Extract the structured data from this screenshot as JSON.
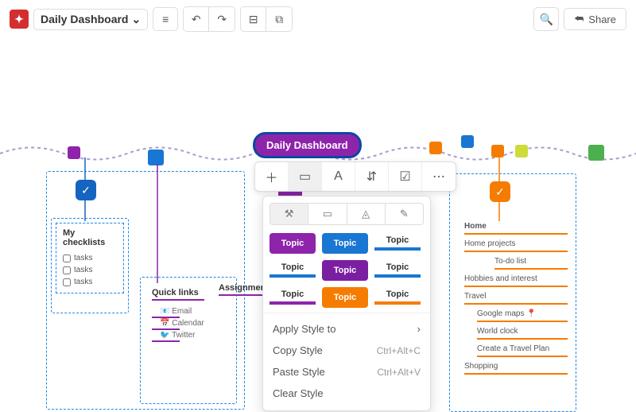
{
  "header": {
    "doc_title": "Daily Dashboard",
    "share_label": "Share"
  },
  "root_node": {
    "label": "Daily Dashboard"
  },
  "checklists_card": {
    "title": "My checklists",
    "items": [
      "tasks",
      "tasks",
      "tasks"
    ]
  },
  "quicklinks_card": {
    "title": "Quick links",
    "items": [
      "Email",
      "Calendar",
      "Twitter"
    ]
  },
  "assignments_card": {
    "title": "Assignments"
  },
  "home_card": {
    "title": "Home",
    "items": [
      "Home projects",
      "To-do list",
      "Hobbies and interest",
      "Travel"
    ],
    "travel_items": [
      "Google maps",
      "World clock",
      "Create a Travel Plan"
    ],
    "shopping": "Shopping"
  },
  "style_panel": {
    "swatch_label": "Topic",
    "menu": {
      "apply": "Apply Style to",
      "copy": "Copy Style",
      "copy_shortcut": "Ctrl+Alt+C",
      "paste": "Paste Style",
      "paste_shortcut": "Ctrl+Alt+V",
      "clear": "Clear Style"
    }
  }
}
